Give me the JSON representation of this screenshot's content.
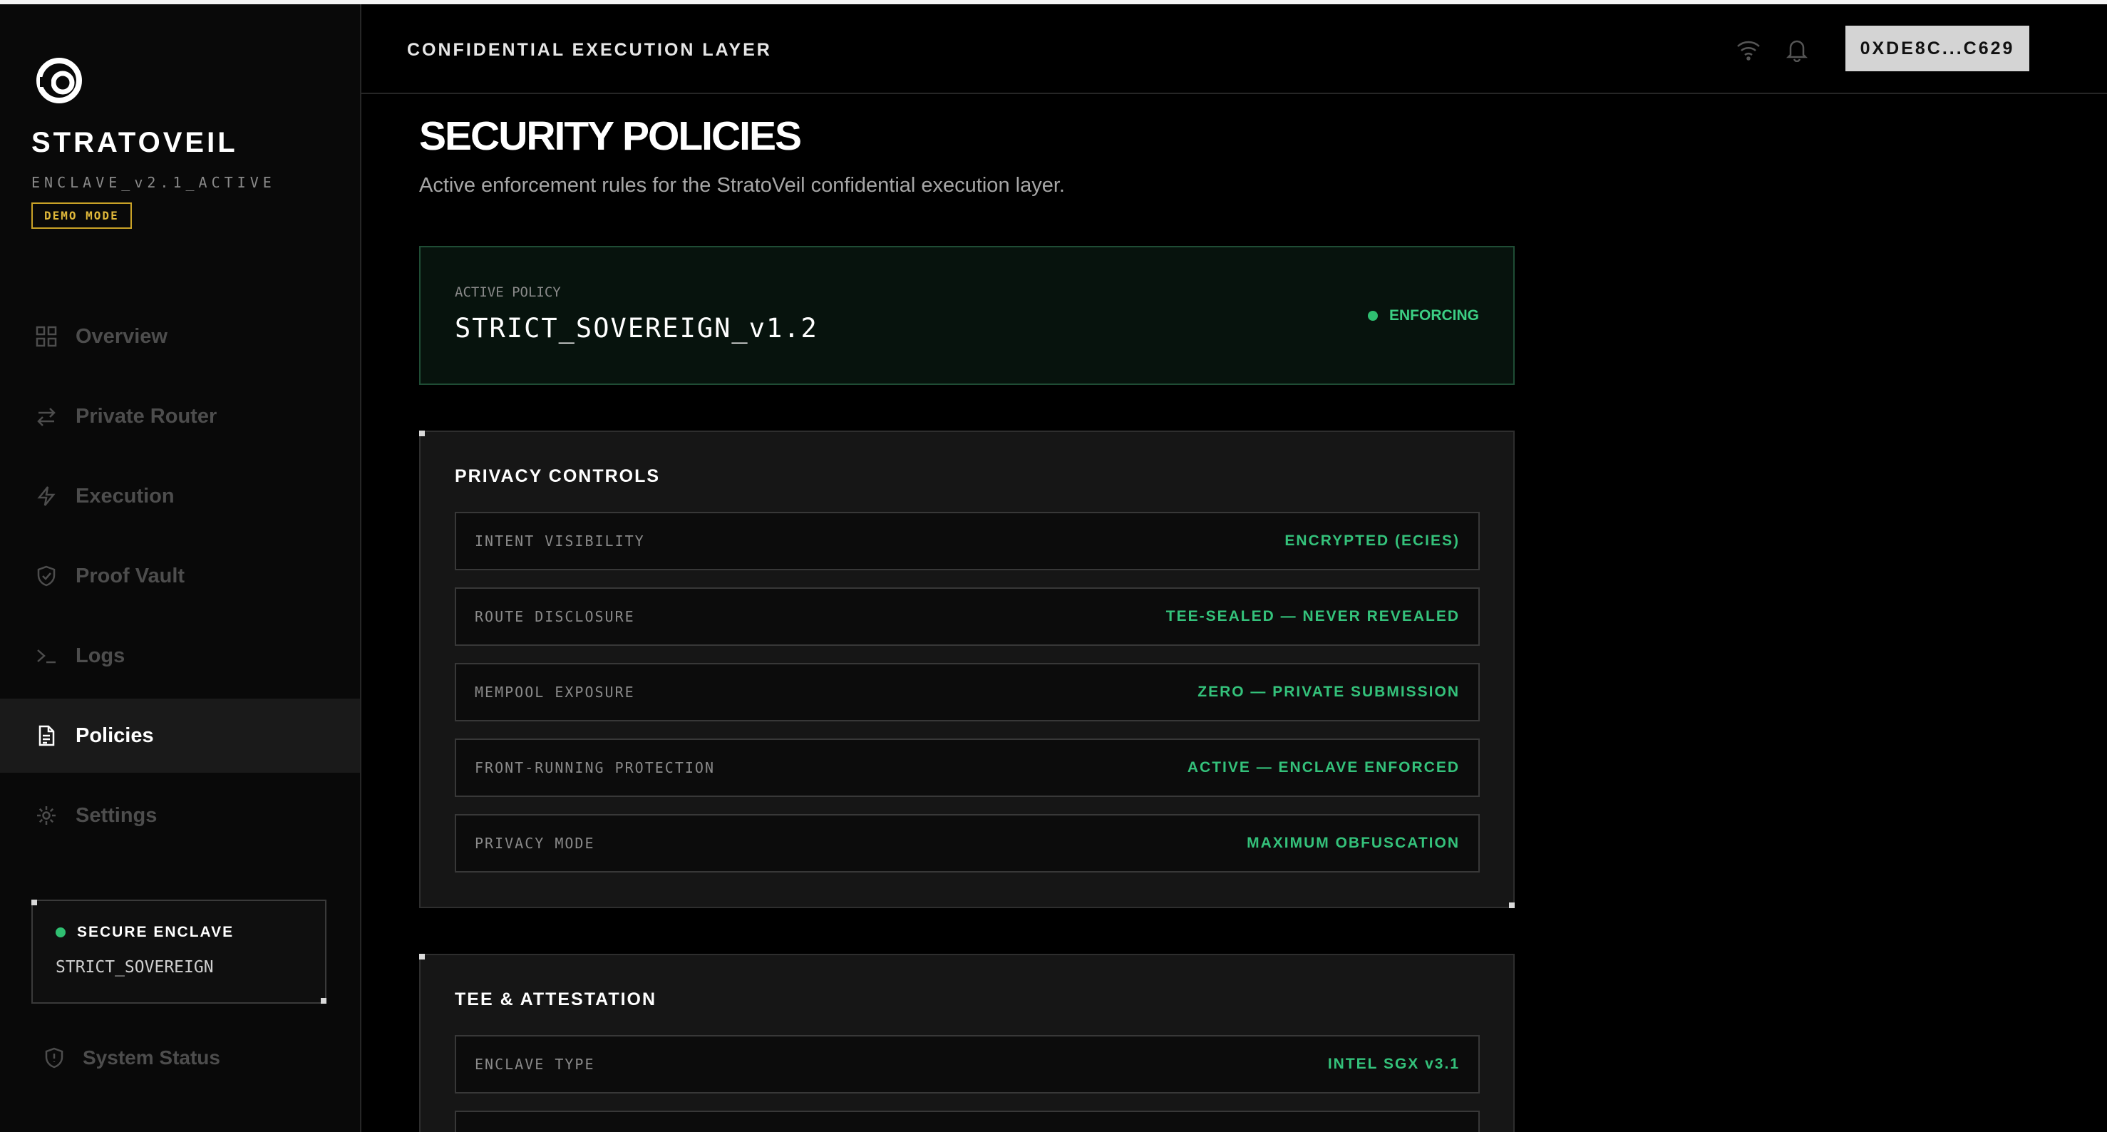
{
  "sidebar": {
    "brand": "STRATOVEIL",
    "version": "ENCLAVE_v2.1_ACTIVE",
    "mode_badge": "DEMO MODE",
    "nav": [
      {
        "label": "Overview",
        "icon": "grid-icon"
      },
      {
        "label": "Private Router",
        "icon": "swap-arrows-icon"
      },
      {
        "label": "Execution",
        "icon": "lightning-icon"
      },
      {
        "label": "Proof Vault",
        "icon": "shield-check-icon"
      },
      {
        "label": "Logs",
        "icon": "terminal-icon"
      },
      {
        "label": "Policies",
        "icon": "document-icon",
        "active": true
      },
      {
        "label": "Settings",
        "icon": "gear-icon"
      }
    ],
    "enclave": {
      "title": "SECURE ENCLAVE",
      "value": "STRICT_SOVEREIGN"
    },
    "system_status": "System Status"
  },
  "header": {
    "title": "CONFIDENTIAL EXECUTION LAYER",
    "wallet": "0XDE8C...C629"
  },
  "main": {
    "title": "SECURITY POLICIES",
    "subtitle": "Active enforcement rules for the StratoVeil confidential execution layer.",
    "active_policy": {
      "label": "ACTIVE POLICY",
      "name": "STRICT_SOVEREIGN_v1.2",
      "status": "ENFORCING"
    },
    "privacy": {
      "title": "PRIVACY CONTROLS",
      "rows": [
        {
          "key": "INTENT VISIBILITY",
          "value": "ENCRYPTED (ECIES)"
        },
        {
          "key": "ROUTE DISCLOSURE",
          "value": "TEE-SEALED — NEVER REVEALED"
        },
        {
          "key": "MEMPOOL EXPOSURE",
          "value": "ZERO — PRIVATE SUBMISSION"
        },
        {
          "key": "FRONT-RUNNING PROTECTION",
          "value": "ACTIVE — ENCLAVE ENFORCED"
        },
        {
          "key": "PRIVACY MODE",
          "value": "MAXIMUM OBFUSCATION"
        }
      ]
    },
    "tee": {
      "title": "TEE & ATTESTATION",
      "rows": [
        {
          "key": "ENCLAVE TYPE",
          "value": "INTEL SGX v3.1"
        }
      ]
    }
  },
  "colors": {
    "accent_green": "#34c27b",
    "demo_gold": "#e0b83a",
    "wallet_bg": "#d4d4d4"
  }
}
